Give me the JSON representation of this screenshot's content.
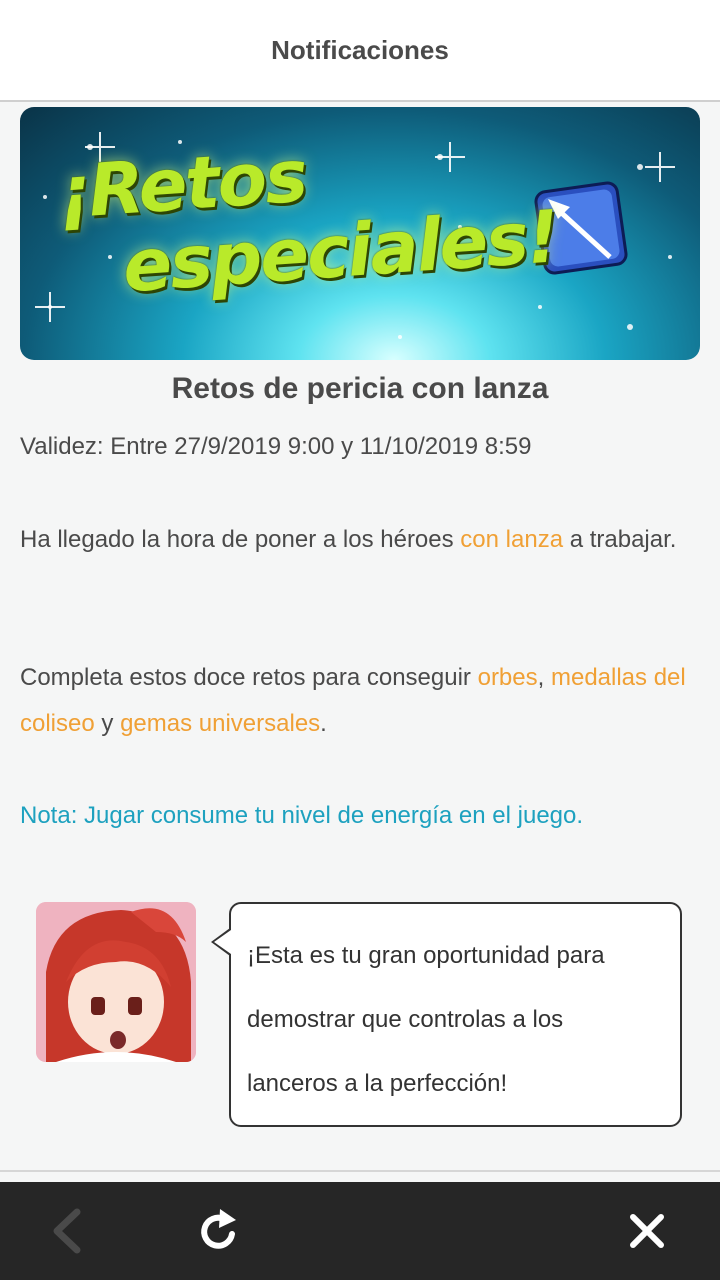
{
  "header": {
    "title": "Notificaciones"
  },
  "banner": {
    "line1": "¡Retos",
    "line2": "especiales!",
    "icon": "lance-icon"
  },
  "post": {
    "title": "Retos de pericia con lanza",
    "validity": "Validez: Entre 27/9/2019 9:00 y 11/10/2019 8:59",
    "p1": {
      "pre": "Ha llegado la hora de poner a los héroes ",
      "highlight": "con lanza",
      "post": " a trabajar."
    },
    "p2": {
      "pre": "Completa estos doce retos para conseguir ",
      "hl1": "orbes",
      "sep1": ", ",
      "hl2": "medallas del coliseo",
      "sep2": " y ",
      "hl3": "gemas universales",
      "end": "."
    },
    "note": "Nota: Jugar consume tu nivel de energía en el juego."
  },
  "character": {
    "avatar": "character-portrait",
    "speech_lines": [
      "¡Esta es tu gran oportunidad para",
      "demostrar que controlas a los",
      "lanceros a la perfección!"
    ]
  },
  "bottom_nav": {
    "back": "back-arrow-icon",
    "refresh": "refresh-icon",
    "close": "close-icon"
  },
  "colors": {
    "highlight": "#f0a035",
    "note": "#1da1bf",
    "bottom_bar": "#262626"
  }
}
